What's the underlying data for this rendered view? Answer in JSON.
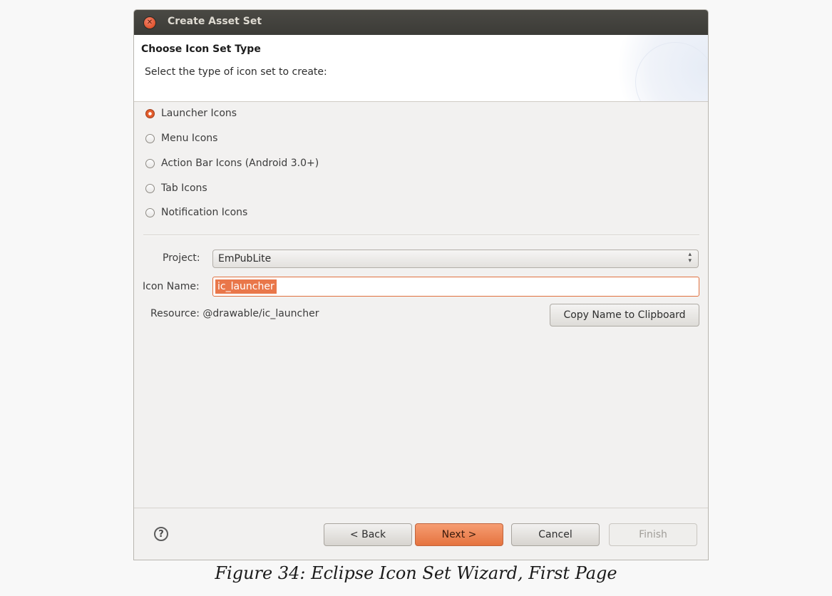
{
  "window": {
    "title": "Create Asset Set"
  },
  "header": {
    "title": "Choose Icon Set Type",
    "description": "Select the type of icon set to create:"
  },
  "icon_types": [
    {
      "label": "Launcher Icons",
      "checked": true
    },
    {
      "label": "Menu Icons",
      "checked": false
    },
    {
      "label": "Action Bar Icons (Android 3.0+)",
      "checked": false
    },
    {
      "label": "Tab Icons",
      "checked": false
    },
    {
      "label": "Notification Icons",
      "checked": false
    }
  ],
  "form": {
    "project_label": "Project:",
    "project_value": "EmPubLite",
    "icon_name_label": "Icon Name:",
    "icon_name_value": "ic_launcher",
    "resource_label": "Resource:",
    "resource_value": "@drawable/ic_launcher",
    "copy_button": "Copy Name to Clipboard"
  },
  "footer": {
    "help_icon": "help-icon",
    "back": "< Back",
    "next": "Next >",
    "cancel": "Cancel",
    "finish": "Finish"
  },
  "colors": {
    "accent": "#e9774a",
    "titlebar": "#3c3b37"
  },
  "caption": "Figure 34: Eclipse Icon Set Wizard, First Page"
}
